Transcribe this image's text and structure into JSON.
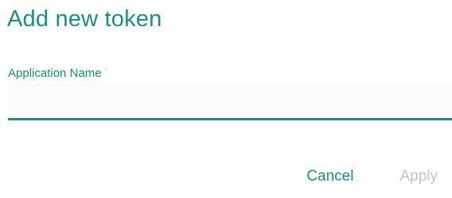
{
  "dialog": {
    "title": "Add new token",
    "field": {
      "label": "Application Name",
      "required_marker": "*",
      "value": "",
      "placeholder": ""
    },
    "actions": {
      "cancel_label": "Cancel",
      "apply_label": "Apply",
      "apply_disabled": true
    },
    "colors": {
      "accent": "#1b8f80",
      "disabled": "#c4c4c4"
    }
  }
}
